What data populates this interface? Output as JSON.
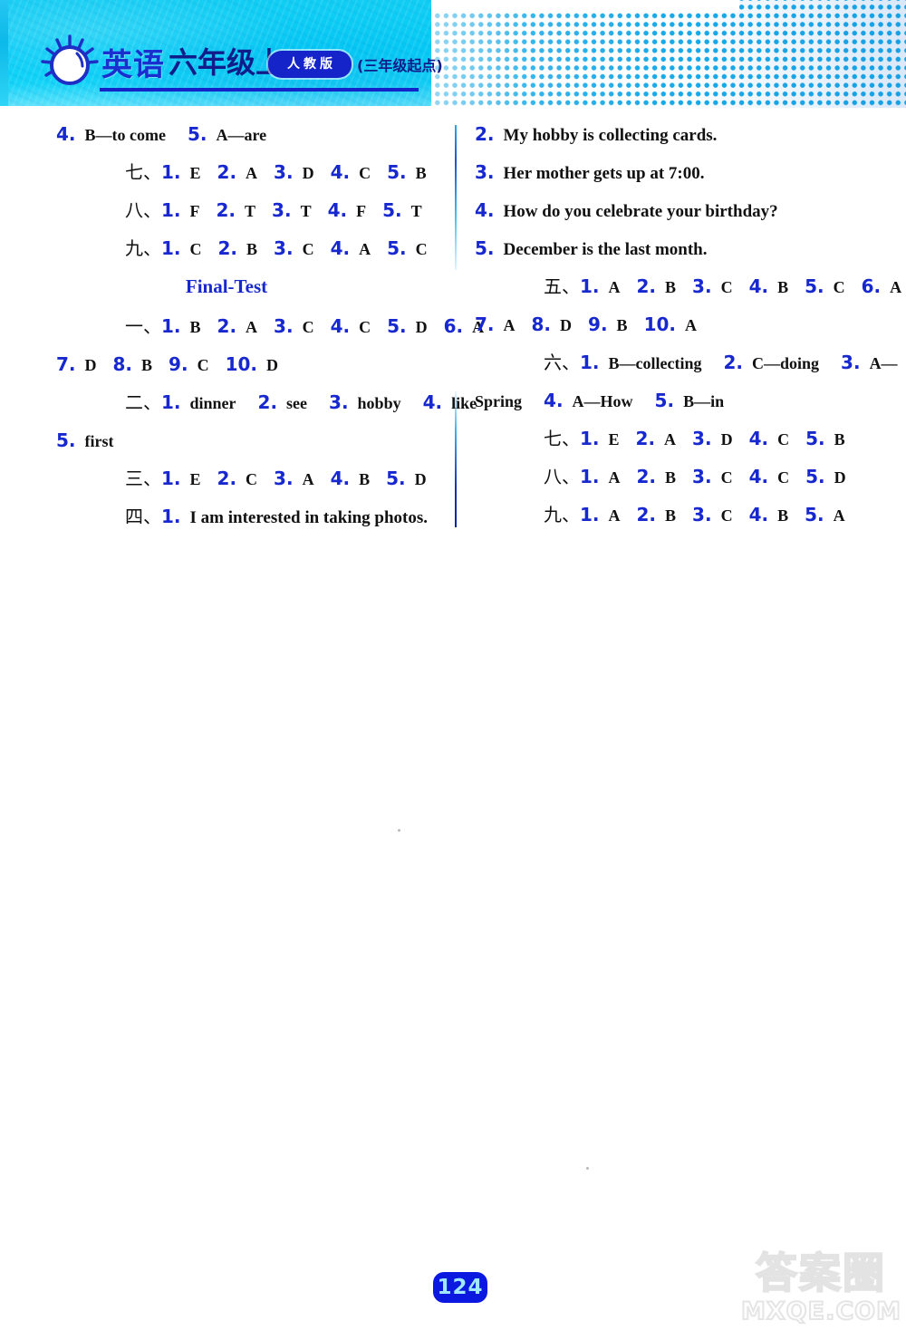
{
  "header": {
    "logo_icon": "sun-icon",
    "subject": "英语",
    "grade": "六年级上",
    "edition_badge": "人教版",
    "edition_note": "(三年级起点)"
  },
  "left_column": [
    {
      "indent": "none",
      "parts": [
        {
          "t": "num",
          "v": "4."
        },
        {
          "t": "sp",
          "v": "s"
        },
        {
          "t": "ans",
          "v": "B—to come"
        },
        {
          "t": "sp",
          "v": "w"
        },
        {
          "t": "num",
          "v": "5."
        },
        {
          "t": "sp",
          "v": "s"
        },
        {
          "t": "ans",
          "v": "A—are"
        }
      ]
    },
    {
      "indent": "big",
      "parts": [
        {
          "t": "cn",
          "v": "七、"
        },
        {
          "t": "num",
          "v": "1."
        },
        {
          "t": "sp",
          "v": "s"
        },
        {
          "t": "ans",
          "v": "E"
        },
        {
          "t": "sp",
          "v": "g"
        },
        {
          "t": "num",
          "v": "2."
        },
        {
          "t": "sp",
          "v": "s"
        },
        {
          "t": "ans",
          "v": "A"
        },
        {
          "t": "sp",
          "v": "g"
        },
        {
          "t": "num",
          "v": "3."
        },
        {
          "t": "sp",
          "v": "s"
        },
        {
          "t": "ans",
          "v": "D"
        },
        {
          "t": "sp",
          "v": "g"
        },
        {
          "t": "num",
          "v": "4."
        },
        {
          "t": "sp",
          "v": "s"
        },
        {
          "t": "ans",
          "v": "C"
        },
        {
          "t": "sp",
          "v": "g"
        },
        {
          "t": "num",
          "v": "5."
        },
        {
          "t": "sp",
          "v": "s"
        },
        {
          "t": "ans",
          "v": "B"
        }
      ]
    },
    {
      "indent": "big",
      "parts": [
        {
          "t": "cn",
          "v": "八、"
        },
        {
          "t": "num",
          "v": "1."
        },
        {
          "t": "sp",
          "v": "s"
        },
        {
          "t": "ans",
          "v": "F"
        },
        {
          "t": "sp",
          "v": "g"
        },
        {
          "t": "num",
          "v": "2."
        },
        {
          "t": "sp",
          "v": "s"
        },
        {
          "t": "ans",
          "v": "T"
        },
        {
          "t": "sp",
          "v": "g"
        },
        {
          "t": "num",
          "v": "3."
        },
        {
          "t": "sp",
          "v": "s"
        },
        {
          "t": "ans",
          "v": "T"
        },
        {
          "t": "sp",
          "v": "g"
        },
        {
          "t": "num",
          "v": "4."
        },
        {
          "t": "sp",
          "v": "s"
        },
        {
          "t": "ans",
          "v": "F"
        },
        {
          "t": "sp",
          "v": "g"
        },
        {
          "t": "num",
          "v": "5."
        },
        {
          "t": "sp",
          "v": "s"
        },
        {
          "t": "ans",
          "v": "T"
        }
      ]
    },
    {
      "indent": "big",
      "parts": [
        {
          "t": "cn",
          "v": "九、"
        },
        {
          "t": "num",
          "v": "1."
        },
        {
          "t": "sp",
          "v": "s"
        },
        {
          "t": "ans",
          "v": "C"
        },
        {
          "t": "sp",
          "v": "g"
        },
        {
          "t": "num",
          "v": "2."
        },
        {
          "t": "sp",
          "v": "s"
        },
        {
          "t": "ans",
          "v": "B"
        },
        {
          "t": "sp",
          "v": "g"
        },
        {
          "t": "num",
          "v": "3."
        },
        {
          "t": "sp",
          "v": "s"
        },
        {
          "t": "ans",
          "v": "C"
        },
        {
          "t": "sp",
          "v": "g"
        },
        {
          "t": "num",
          "v": "4."
        },
        {
          "t": "sp",
          "v": "s"
        },
        {
          "t": "ans",
          "v": "A"
        },
        {
          "t": "sp",
          "v": "g"
        },
        {
          "t": "num",
          "v": "5."
        },
        {
          "t": "sp",
          "v": "s"
        },
        {
          "t": "ans",
          "v": "C"
        }
      ]
    },
    {
      "indent": "head",
      "heading": "Final-Test"
    },
    {
      "indent": "big",
      "parts": [
        {
          "t": "cn",
          "v": "一、"
        },
        {
          "t": "num",
          "v": "1."
        },
        {
          "t": "sp",
          "v": "s"
        },
        {
          "t": "ans",
          "v": "B"
        },
        {
          "t": "sp",
          "v": "g"
        },
        {
          "t": "num",
          "v": "2."
        },
        {
          "t": "sp",
          "v": "s"
        },
        {
          "t": "ans",
          "v": "A"
        },
        {
          "t": "sp",
          "v": "g"
        },
        {
          "t": "num",
          "v": "3."
        },
        {
          "t": "sp",
          "v": "s"
        },
        {
          "t": "ans",
          "v": "C"
        },
        {
          "t": "sp",
          "v": "g"
        },
        {
          "t": "num",
          "v": "4."
        },
        {
          "t": "sp",
          "v": "s"
        },
        {
          "t": "ans",
          "v": "C"
        },
        {
          "t": "sp",
          "v": "g"
        },
        {
          "t": "num",
          "v": "5."
        },
        {
          "t": "sp",
          "v": "s"
        },
        {
          "t": "ans",
          "v": "D"
        },
        {
          "t": "sp",
          "v": "g"
        },
        {
          "t": "num",
          "v": "6."
        },
        {
          "t": "sp",
          "v": "s"
        },
        {
          "t": "ans",
          "v": "A"
        }
      ]
    },
    {
      "indent": "none",
      "parts": [
        {
          "t": "num",
          "v": "7."
        },
        {
          "t": "sp",
          "v": "s"
        },
        {
          "t": "ans",
          "v": "D"
        },
        {
          "t": "sp",
          "v": "g"
        },
        {
          "t": "num",
          "v": "8."
        },
        {
          "t": "sp",
          "v": "s"
        },
        {
          "t": "ans",
          "v": "B"
        },
        {
          "t": "sp",
          "v": "g"
        },
        {
          "t": "num",
          "v": "9."
        },
        {
          "t": "sp",
          "v": "s"
        },
        {
          "t": "ans",
          "v": "C"
        },
        {
          "t": "sp",
          "v": "g"
        },
        {
          "t": "num",
          "v": "10."
        },
        {
          "t": "sp",
          "v": "s"
        },
        {
          "t": "ans",
          "v": "D"
        }
      ]
    },
    {
      "indent": "big",
      "parts": [
        {
          "t": "cn",
          "v": "二、"
        },
        {
          "t": "num",
          "v": "1."
        },
        {
          "t": "sp",
          "v": "s"
        },
        {
          "t": "ans",
          "v": "dinner"
        },
        {
          "t": "sp",
          "v": "w"
        },
        {
          "t": "num",
          "v": "2."
        },
        {
          "t": "sp",
          "v": "s"
        },
        {
          "t": "ans",
          "v": "see"
        },
        {
          "t": "sp",
          "v": "w"
        },
        {
          "t": "num",
          "v": "3."
        },
        {
          "t": "sp",
          "v": "s"
        },
        {
          "t": "ans",
          "v": "hobby"
        },
        {
          "t": "sp",
          "v": "w"
        },
        {
          "t": "num",
          "v": "4."
        },
        {
          "t": "sp",
          "v": "s"
        },
        {
          "t": "ans",
          "v": "like"
        }
      ]
    },
    {
      "indent": "none",
      "parts": [
        {
          "t": "num",
          "v": "5."
        },
        {
          "t": "sp",
          "v": "s"
        },
        {
          "t": "ans",
          "v": "first"
        }
      ]
    },
    {
      "indent": "big",
      "parts": [
        {
          "t": "cn",
          "v": "三、"
        },
        {
          "t": "num",
          "v": "1."
        },
        {
          "t": "sp",
          "v": "s"
        },
        {
          "t": "ans",
          "v": "E"
        },
        {
          "t": "sp",
          "v": "g"
        },
        {
          "t": "num",
          "v": "2."
        },
        {
          "t": "sp",
          "v": "s"
        },
        {
          "t": "ans",
          "v": "C"
        },
        {
          "t": "sp",
          "v": "g"
        },
        {
          "t": "num",
          "v": "3."
        },
        {
          "t": "sp",
          "v": "s"
        },
        {
          "t": "ans",
          "v": "A"
        },
        {
          "t": "sp",
          "v": "g"
        },
        {
          "t": "num",
          "v": "4."
        },
        {
          "t": "sp",
          "v": "s"
        },
        {
          "t": "ans",
          "v": "B"
        },
        {
          "t": "sp",
          "v": "g"
        },
        {
          "t": "num",
          "v": "5."
        },
        {
          "t": "sp",
          "v": "s"
        },
        {
          "t": "ans",
          "v": "D"
        }
      ]
    },
    {
      "indent": "big",
      "parts": [
        {
          "t": "cn",
          "v": "四、"
        },
        {
          "t": "num",
          "v": "1."
        },
        {
          "t": "sp",
          "v": "s"
        },
        {
          "t": "sent",
          "v": "I am interested in taking photos."
        }
      ]
    }
  ],
  "right_column": [
    {
      "indent": "none",
      "parts": [
        {
          "t": "num",
          "v": "2."
        },
        {
          "t": "sp",
          "v": "s"
        },
        {
          "t": "sent",
          "v": "My hobby is collecting cards."
        }
      ]
    },
    {
      "indent": "none",
      "parts": [
        {
          "t": "num",
          "v": "3."
        },
        {
          "t": "sp",
          "v": "s"
        },
        {
          "t": "sent",
          "v": "Her mother gets up at 7:00."
        }
      ]
    },
    {
      "indent": "none",
      "parts": [
        {
          "t": "num",
          "v": "4."
        },
        {
          "t": "sp",
          "v": "s"
        },
        {
          "t": "sent",
          "v": "How do you celebrate your birthday?"
        }
      ]
    },
    {
      "indent": "none",
      "parts": [
        {
          "t": "num",
          "v": "5."
        },
        {
          "t": "sp",
          "v": "s"
        },
        {
          "t": "sent",
          "v": "December is the last month."
        }
      ]
    },
    {
      "indent": "big",
      "parts": [
        {
          "t": "cn",
          "v": "五、"
        },
        {
          "t": "num",
          "v": "1."
        },
        {
          "t": "sp",
          "v": "s"
        },
        {
          "t": "ans",
          "v": "A"
        },
        {
          "t": "sp",
          "v": "g"
        },
        {
          "t": "num",
          "v": "2."
        },
        {
          "t": "sp",
          "v": "s"
        },
        {
          "t": "ans",
          "v": "B"
        },
        {
          "t": "sp",
          "v": "g"
        },
        {
          "t": "num",
          "v": "3."
        },
        {
          "t": "sp",
          "v": "s"
        },
        {
          "t": "ans",
          "v": "C"
        },
        {
          "t": "sp",
          "v": "g"
        },
        {
          "t": "num",
          "v": "4."
        },
        {
          "t": "sp",
          "v": "s"
        },
        {
          "t": "ans",
          "v": "B"
        },
        {
          "t": "sp",
          "v": "g"
        },
        {
          "t": "num",
          "v": "5."
        },
        {
          "t": "sp",
          "v": "s"
        },
        {
          "t": "ans",
          "v": "C"
        },
        {
          "t": "sp",
          "v": "g"
        },
        {
          "t": "num",
          "v": "6."
        },
        {
          "t": "sp",
          "v": "s"
        },
        {
          "t": "ans",
          "v": "A"
        }
      ]
    },
    {
      "indent": "none",
      "parts": [
        {
          "t": "num",
          "v": "7."
        },
        {
          "t": "sp",
          "v": "s"
        },
        {
          "t": "ans",
          "v": "A"
        },
        {
          "t": "sp",
          "v": "g"
        },
        {
          "t": "num",
          "v": "8."
        },
        {
          "t": "sp",
          "v": "s"
        },
        {
          "t": "ans",
          "v": "D"
        },
        {
          "t": "sp",
          "v": "g"
        },
        {
          "t": "num",
          "v": "9."
        },
        {
          "t": "sp",
          "v": "s"
        },
        {
          "t": "ans",
          "v": "B"
        },
        {
          "t": "sp",
          "v": "g"
        },
        {
          "t": "num",
          "v": "10."
        },
        {
          "t": "sp",
          "v": "s"
        },
        {
          "t": "ans",
          "v": "A"
        }
      ]
    },
    {
      "indent": "big",
      "parts": [
        {
          "t": "cn",
          "v": "六、"
        },
        {
          "t": "num",
          "v": "1."
        },
        {
          "t": "sp",
          "v": "s"
        },
        {
          "t": "ans",
          "v": "B—collecting"
        },
        {
          "t": "sp",
          "v": "w"
        },
        {
          "t": "num",
          "v": "2."
        },
        {
          "t": "sp",
          "v": "s"
        },
        {
          "t": "ans",
          "v": "C—doing"
        },
        {
          "t": "sp",
          "v": "w"
        },
        {
          "t": "num",
          "v": "3."
        },
        {
          "t": "sp",
          "v": "s"
        },
        {
          "t": "ans",
          "v": "A—"
        }
      ]
    },
    {
      "indent": "none",
      "parts": [
        {
          "t": "ans",
          "v": "Spring"
        },
        {
          "t": "sp",
          "v": "w"
        },
        {
          "t": "num",
          "v": "4."
        },
        {
          "t": "sp",
          "v": "s"
        },
        {
          "t": "ans",
          "v": "A—How"
        },
        {
          "t": "sp",
          "v": "w"
        },
        {
          "t": "num",
          "v": "5."
        },
        {
          "t": "sp",
          "v": "s"
        },
        {
          "t": "ans",
          "v": "B—in"
        }
      ]
    },
    {
      "indent": "big",
      "parts": [
        {
          "t": "cn",
          "v": "七、"
        },
        {
          "t": "num",
          "v": "1."
        },
        {
          "t": "sp",
          "v": "s"
        },
        {
          "t": "ans",
          "v": "E"
        },
        {
          "t": "sp",
          "v": "g"
        },
        {
          "t": "num",
          "v": "2."
        },
        {
          "t": "sp",
          "v": "s"
        },
        {
          "t": "ans",
          "v": "A"
        },
        {
          "t": "sp",
          "v": "g"
        },
        {
          "t": "num",
          "v": "3."
        },
        {
          "t": "sp",
          "v": "s"
        },
        {
          "t": "ans",
          "v": "D"
        },
        {
          "t": "sp",
          "v": "g"
        },
        {
          "t": "num",
          "v": "4."
        },
        {
          "t": "sp",
          "v": "s"
        },
        {
          "t": "ans",
          "v": "C"
        },
        {
          "t": "sp",
          "v": "g"
        },
        {
          "t": "num",
          "v": "5."
        },
        {
          "t": "sp",
          "v": "s"
        },
        {
          "t": "ans",
          "v": "B"
        }
      ]
    },
    {
      "indent": "big",
      "parts": [
        {
          "t": "cn",
          "v": "八、"
        },
        {
          "t": "num",
          "v": "1."
        },
        {
          "t": "sp",
          "v": "s"
        },
        {
          "t": "ans",
          "v": "A"
        },
        {
          "t": "sp",
          "v": "g"
        },
        {
          "t": "num",
          "v": "2."
        },
        {
          "t": "sp",
          "v": "s"
        },
        {
          "t": "ans",
          "v": "B"
        },
        {
          "t": "sp",
          "v": "g"
        },
        {
          "t": "num",
          "v": "3."
        },
        {
          "t": "sp",
          "v": "s"
        },
        {
          "t": "ans",
          "v": "C"
        },
        {
          "t": "sp",
          "v": "g"
        },
        {
          "t": "num",
          "v": "4."
        },
        {
          "t": "sp",
          "v": "s"
        },
        {
          "t": "ans",
          "v": "C"
        },
        {
          "t": "sp",
          "v": "g"
        },
        {
          "t": "num",
          "v": "5."
        },
        {
          "t": "sp",
          "v": "s"
        },
        {
          "t": "ans",
          "v": "D"
        }
      ]
    },
    {
      "indent": "big",
      "parts": [
        {
          "t": "cn",
          "v": "九、"
        },
        {
          "t": "num",
          "v": "1."
        },
        {
          "t": "sp",
          "v": "s"
        },
        {
          "t": "ans",
          "v": "A"
        },
        {
          "t": "sp",
          "v": "g"
        },
        {
          "t": "num",
          "v": "2."
        },
        {
          "t": "sp",
          "v": "s"
        },
        {
          "t": "ans",
          "v": "B"
        },
        {
          "t": "sp",
          "v": "g"
        },
        {
          "t": "num",
          "v": "3."
        },
        {
          "t": "sp",
          "v": "s"
        },
        {
          "t": "ans",
          "v": "C"
        },
        {
          "t": "sp",
          "v": "g"
        },
        {
          "t": "num",
          "v": "4."
        },
        {
          "t": "sp",
          "v": "s"
        },
        {
          "t": "ans",
          "v": "B"
        },
        {
          "t": "sp",
          "v": "g"
        },
        {
          "t": "num",
          "v": "5."
        },
        {
          "t": "sp",
          "v": "s"
        },
        {
          "t": "ans",
          "v": "A"
        }
      ]
    }
  ],
  "footer": {
    "page_number": "124",
    "watermark_cn": "答案圈",
    "watermark_en": "MXQE.COM"
  },
  "colors": {
    "accent_blue": "#1728cf",
    "header_cyan": "#06cdf6",
    "ink": "#111111"
  }
}
